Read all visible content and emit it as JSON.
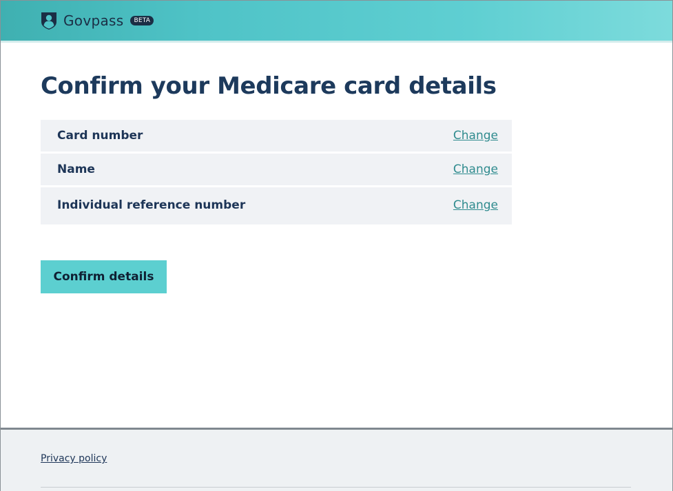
{
  "header": {
    "brand": "Govpass",
    "badge": "BETA",
    "logo_icon": "shield-person-icon",
    "gradient_start": "#3fb0b1",
    "gradient_end": "#7ddbdc"
  },
  "main": {
    "title": "Confirm your Medicare card details",
    "summary_rows": [
      {
        "label": "Card number",
        "action": "Change"
      },
      {
        "label": "Name",
        "action": "Change"
      },
      {
        "label": "Individual reference number",
        "action": "Change"
      }
    ],
    "confirm_button": "Confirm details",
    "accent_color": "#5ccfd0",
    "link_color": "#2f8b8e"
  },
  "footer": {
    "privacy_link": "Privacy policy"
  }
}
